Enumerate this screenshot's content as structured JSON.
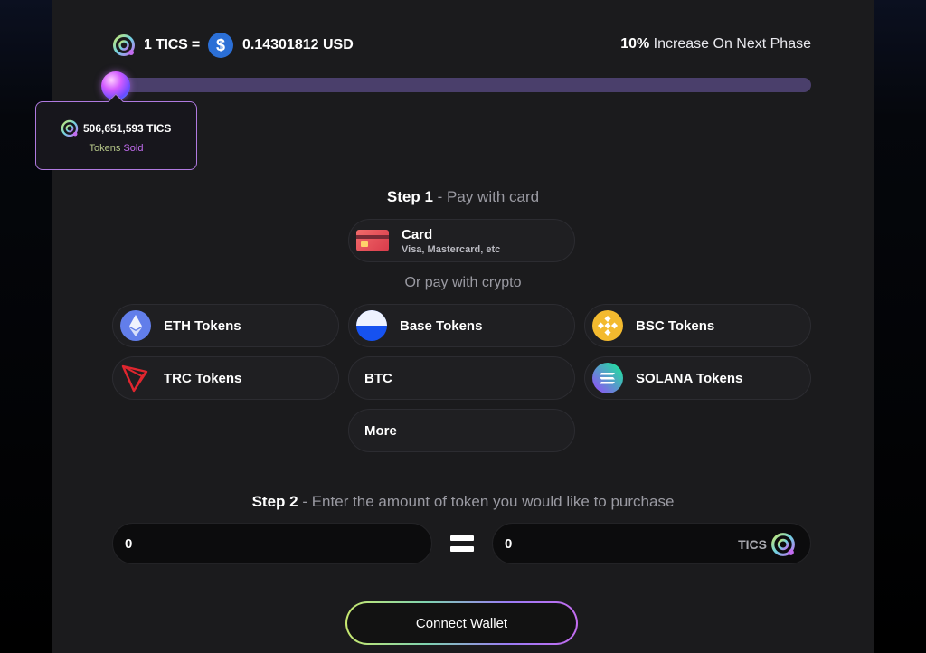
{
  "rate": {
    "tics_label": "1 TICS =",
    "usd_symbol": "$",
    "usd_value": "0.14301812 USD",
    "increase_percent": "10%",
    "increase_text": " Increase On Next Phase"
  },
  "progress": {
    "sold_amount": "506,651,593 TICS",
    "sold_label_a": "Token",
    "sold_label_b": "s ",
    "sold_label_c": "Sold"
  },
  "step1": {
    "title": "Step 1",
    "subtitle": " - Pay with card",
    "card": {
      "label": "Card",
      "sub": "Visa, Mastercard, etc"
    },
    "or_crypto": "Or pay with crypto",
    "options": {
      "eth": "ETH Tokens",
      "base": "Base Tokens",
      "bsc": "BSC Tokens",
      "trc": "TRC Tokens",
      "btc": "BTC",
      "solana": "SOLANA Tokens",
      "more": "More"
    }
  },
  "step2": {
    "title": "Step 2",
    "subtitle": " - Enter the amount of token you would like to purchase",
    "pay_value": "0",
    "receive_value": "0",
    "receive_unit": "TICS"
  },
  "connect_wallet": "Connect Wallet",
  "colors": {
    "accent_purple": "#c36cf0",
    "progress_track": "#4a3f6b",
    "usd_blue": "#2b6fd6"
  }
}
